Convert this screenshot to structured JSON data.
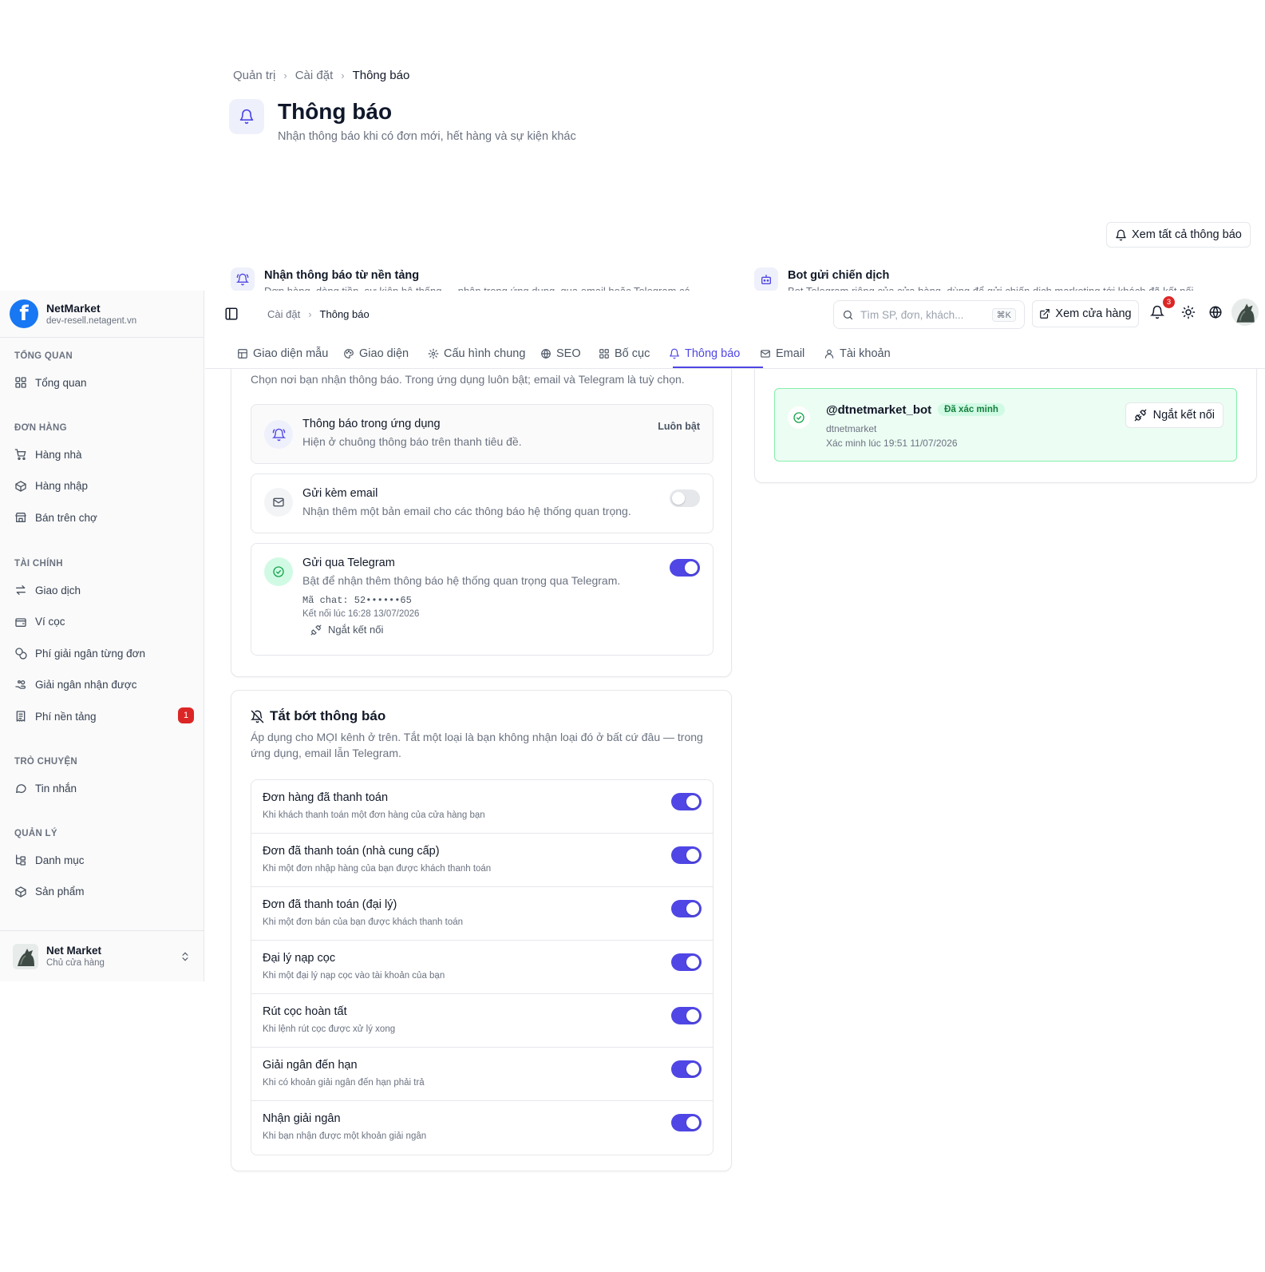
{
  "page_header": {
    "breadcrumb": [
      "Quản trị",
      "Cài đặt",
      "Thông báo"
    ],
    "title": "Thông báo",
    "subtitle": "Nhận thông báo khi có đơn mới, hết hàng và sự kiện khác",
    "view_all_label": "Xem tất cả thông báo",
    "platform_title": "Nhận thông báo từ nền tảng",
    "platform_desc": "Đơn hàng, dòng tiền, sự kiện hệ thống — nhận trong ứng dụng, qua email hoặc Telegram cá",
    "bot_title": "Bot gửi chiến dịch",
    "bot_desc": "Bot Telegram riêng của cửa hàng, dùng để gửi chiến dịch marketing tới khách đã kết nối"
  },
  "sidebar": {
    "brand_name": "NetMarket",
    "brand_domain": "dev-resell.netagent.vn",
    "sections": [
      {
        "title": "TỔNG QUAN",
        "items": [
          {
            "label": "Tổng quan",
            "icon": "dashboard-icon"
          }
        ]
      },
      {
        "title": "ĐƠN HÀNG",
        "items": [
          {
            "label": "Hàng nhà",
            "icon": "cart-icon"
          },
          {
            "label": "Hàng nhập",
            "icon": "package-icon"
          },
          {
            "label": "Bán trên chợ",
            "icon": "store-icon"
          }
        ]
      },
      {
        "title": "TÀI CHÍNH",
        "items": [
          {
            "label": "Giao dịch",
            "icon": "transfer-icon"
          },
          {
            "label": "Ví cọc",
            "icon": "wallet-icon"
          },
          {
            "label": "Phí giải ngân từng đơn",
            "icon": "coins-icon"
          },
          {
            "label": "Giải ngân nhận được",
            "icon": "hand-coins-icon"
          },
          {
            "label": "Phí nền tảng",
            "icon": "receipt-icon",
            "badge": "1"
          }
        ]
      },
      {
        "title": "TRÒ CHUYỆN",
        "items": [
          {
            "label": "Tin nhắn",
            "icon": "message-icon"
          }
        ]
      },
      {
        "title": "QUẢN LÝ",
        "items": [
          {
            "label": "Danh mục",
            "icon": "folder-tree-icon"
          },
          {
            "label": "Sản phẩm",
            "icon": "box-icon"
          }
        ]
      }
    ],
    "user_name": "Net Market",
    "user_role": "Chủ cửa hàng"
  },
  "topbar": {
    "breadcrumb": [
      "Cài đặt",
      "Thông báo"
    ],
    "search_placeholder": "Tìm SP, đơn, khách...",
    "search_shortcut": "⌘K",
    "view_store_label": "Xem cửa hàng",
    "notification_count": "3"
  },
  "tabs": [
    {
      "label": "Giao diện mẫu",
      "icon": "template-icon",
      "active": false
    },
    {
      "label": "Giao diện",
      "icon": "palette-icon",
      "active": false
    },
    {
      "label": "Cấu hình chung",
      "icon": "gear-icon",
      "active": false
    },
    {
      "label": "SEO",
      "icon": "globe-icon",
      "active": false
    },
    {
      "label": "Bố cục",
      "icon": "layout-icon",
      "active": false
    },
    {
      "label": "Thông báo",
      "icon": "bell-icon",
      "active": true
    },
    {
      "label": "Email",
      "icon": "mail-icon",
      "active": false
    },
    {
      "label": "Tài khoản",
      "icon": "user-icon",
      "active": false
    }
  ],
  "channels": {
    "description": "Chọn nơi bạn nhận thông báo. Trong ứng dụng luôn bật; email và Telegram là tuỳ chọn.",
    "in_app": {
      "title": "Thông báo trong ứng dụng",
      "desc": "Hiện ở chuông thông báo trên thanh tiêu đề.",
      "tag": "Luôn bật"
    },
    "email": {
      "title": "Gửi kèm email",
      "desc": "Nhận thêm một bản email cho các thông báo hệ thống quan trọng.",
      "enabled": false
    },
    "telegram": {
      "title": "Gửi qua Telegram",
      "desc": "Bật để nhận thêm thông báo hệ thống quan trọng qua Telegram.",
      "chat_id": "Mã chat: 52••••••65",
      "connected_at": "Kết nối lúc 16:28 13/07/2026",
      "disconnect_label": "Ngắt kết nối",
      "enabled": true
    }
  },
  "bot_card": {
    "username": "@dtnetmarket_bot",
    "status": "Đã xác minh",
    "store": "dtnetmarket",
    "verified_at": "Xác minh lúc 19:51 11/07/2026",
    "disconnect_label": "Ngắt kết nối"
  },
  "mute": {
    "title": "Tắt bớt thông báo",
    "description": "Áp dụng cho MỌI kênh ở trên. Tắt một loại là bạn không nhận loại đó ở bất cứ đâu — trong ứng dụng, email lẫn Telegram.",
    "items": [
      {
        "title": "Đơn hàng đã thanh toán",
        "desc": "Khi khách thanh toán một đơn hàng của cửa hàng bạn",
        "enabled": true
      },
      {
        "title": "Đơn đã thanh toán (nhà cung cấp)",
        "desc": "Khi một đơn nhập hàng của bạn được khách thanh toán",
        "enabled": true
      },
      {
        "title": "Đơn đã thanh toán (đại lý)",
        "desc": "Khi một đơn bán của bạn được khách thanh toán",
        "enabled": true
      },
      {
        "title": "Đại lý nạp cọc",
        "desc": "Khi một đại lý nạp cọc vào tài khoản của bạn",
        "enabled": true
      },
      {
        "title": "Rút cọc hoàn tất",
        "desc": "Khi lệnh rút cọc được xử lý xong",
        "enabled": true
      },
      {
        "title": "Giải ngân đến hạn",
        "desc": "Khi có khoản giải ngân đến hạn phải trả",
        "enabled": true
      },
      {
        "title": "Nhận giải ngân",
        "desc": "Khi bạn nhận được một khoản giải ngân",
        "enabled": true
      }
    ]
  },
  "colors": {
    "accent": "#4f46e5",
    "success_bg": "#ecfdf3",
    "danger": "#dc2626"
  }
}
